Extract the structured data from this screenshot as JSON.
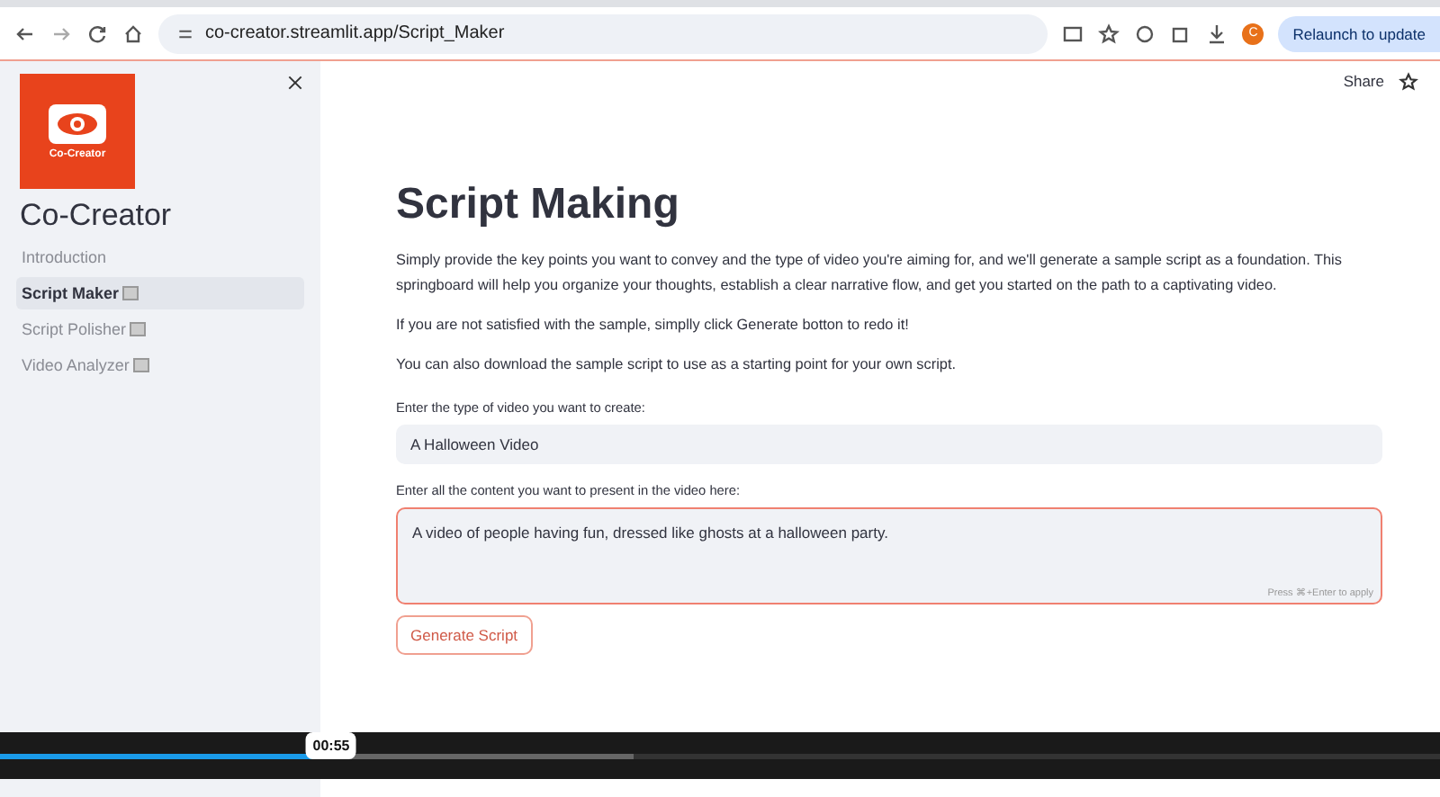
{
  "browser": {
    "url": "co-creator.streamlit.app/Script_Maker",
    "relaunch": "Relaunch to update",
    "profile": "C"
  },
  "sidebar": {
    "logo_text": "Co-Creator",
    "title": "Co-Creator",
    "items": [
      {
        "label": "Introduction",
        "selected": false,
        "icon": false
      },
      {
        "label": "Script Maker",
        "selected": true,
        "icon": true
      },
      {
        "label": "Script Polisher",
        "selected": false,
        "icon": true
      },
      {
        "label": "Video Analyzer",
        "selected": false,
        "icon": true
      }
    ]
  },
  "header": {
    "share": "Share"
  },
  "main": {
    "title": "Script Making",
    "paragraphs": [
      "Simply provide the key points you want to convey and the type of video you're aiming for, and we'll generate a sample script as a foundation. This springboard will help you organize your thoughts, establish a clear narrative flow, and get you started on the path to a captivating video.",
      "If you are not satisfied with the sample, simplly click Generate botton to redo it!",
      "You can also download the sample script to use as a starting point for your own script."
    ],
    "video_type": {
      "label": "Enter the type of video you want to create:",
      "value": "A Halloween Video"
    },
    "content": {
      "label": "Enter all the content you want to present in the video here:",
      "value": "A video of people having fun, dressed like ghosts at a halloween party.",
      "hint": "Press ⌘+Enter to apply",
      "focused": true
    },
    "button": "Generate Script"
  },
  "player": {
    "time": "00:55",
    "level": 0.23
  }
}
